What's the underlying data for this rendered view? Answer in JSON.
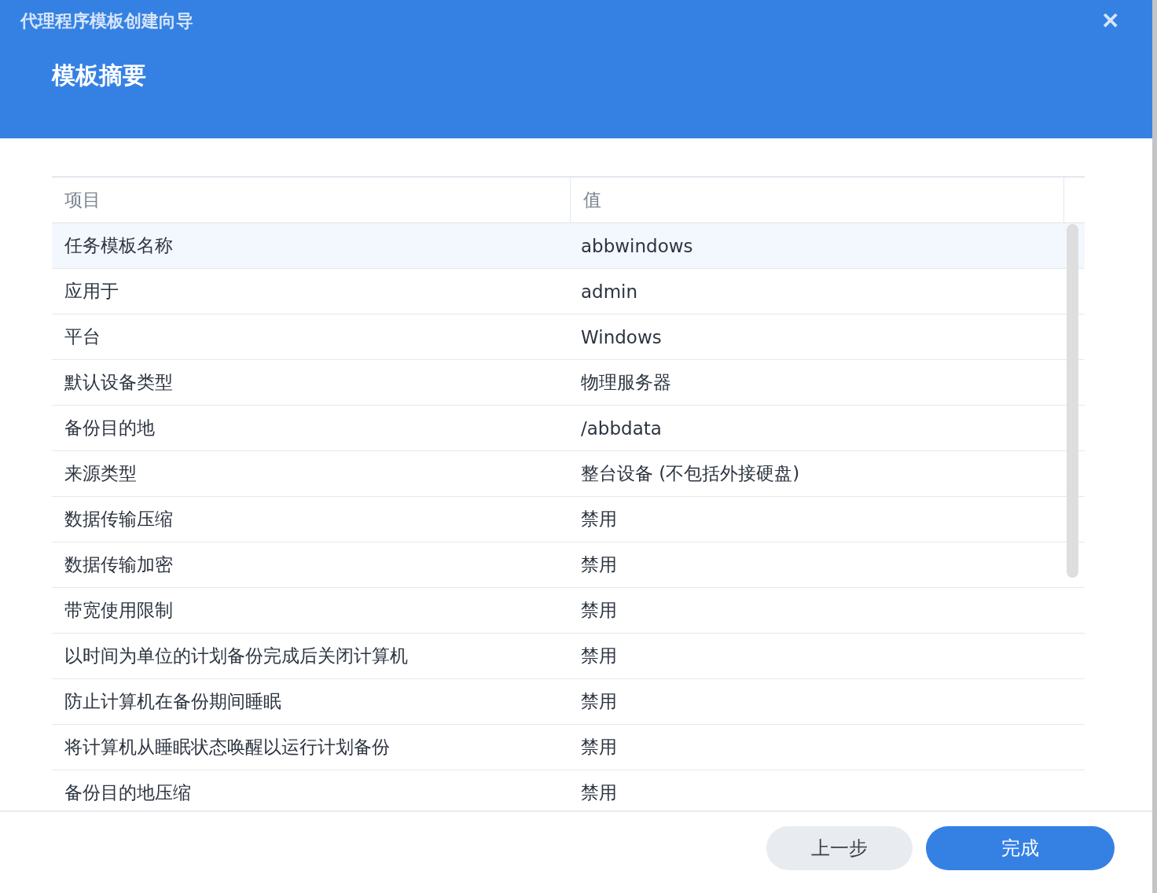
{
  "window": {
    "title": "代理程序模板创建向导",
    "close": "✕"
  },
  "heading": "模板摘要",
  "table": {
    "columns": [
      "项目",
      "值"
    ],
    "rows": [
      {
        "item": "任务模板名称",
        "value": "abbwindows",
        "selected": true
      },
      {
        "item": "应用于",
        "value": "admin",
        "selected": false
      },
      {
        "item": "平台",
        "value": "Windows",
        "selected": false
      },
      {
        "item": "默认设备类型",
        "value": "物理服务器",
        "selected": false
      },
      {
        "item": "备份目的地",
        "value": "/abbdata",
        "selected": false
      },
      {
        "item": "来源类型",
        "value": "整台设备 (不包括外接硬盘)",
        "selected": false
      },
      {
        "item": "数据传输压缩",
        "value": "禁用",
        "selected": false
      },
      {
        "item": "数据传输加密",
        "value": "禁用",
        "selected": false
      },
      {
        "item": "带宽使用限制",
        "value": "禁用",
        "selected": false
      },
      {
        "item": "以时间为单位的计划备份完成后关闭计算机",
        "value": "禁用",
        "selected": false
      },
      {
        "item": "防止计算机在备份期间睡眠",
        "value": "禁用",
        "selected": false
      },
      {
        "item": "将计算机从睡眠状态唤醒以运行计划备份",
        "value": "禁用",
        "selected": false
      },
      {
        "item": "备份目的地压缩",
        "value": "禁用",
        "selected": false
      }
    ]
  },
  "buttons": [
    {
      "label": "上一步",
      "kind": "secondary"
    },
    {
      "label": "完成",
      "kind": "primary"
    }
  ]
}
